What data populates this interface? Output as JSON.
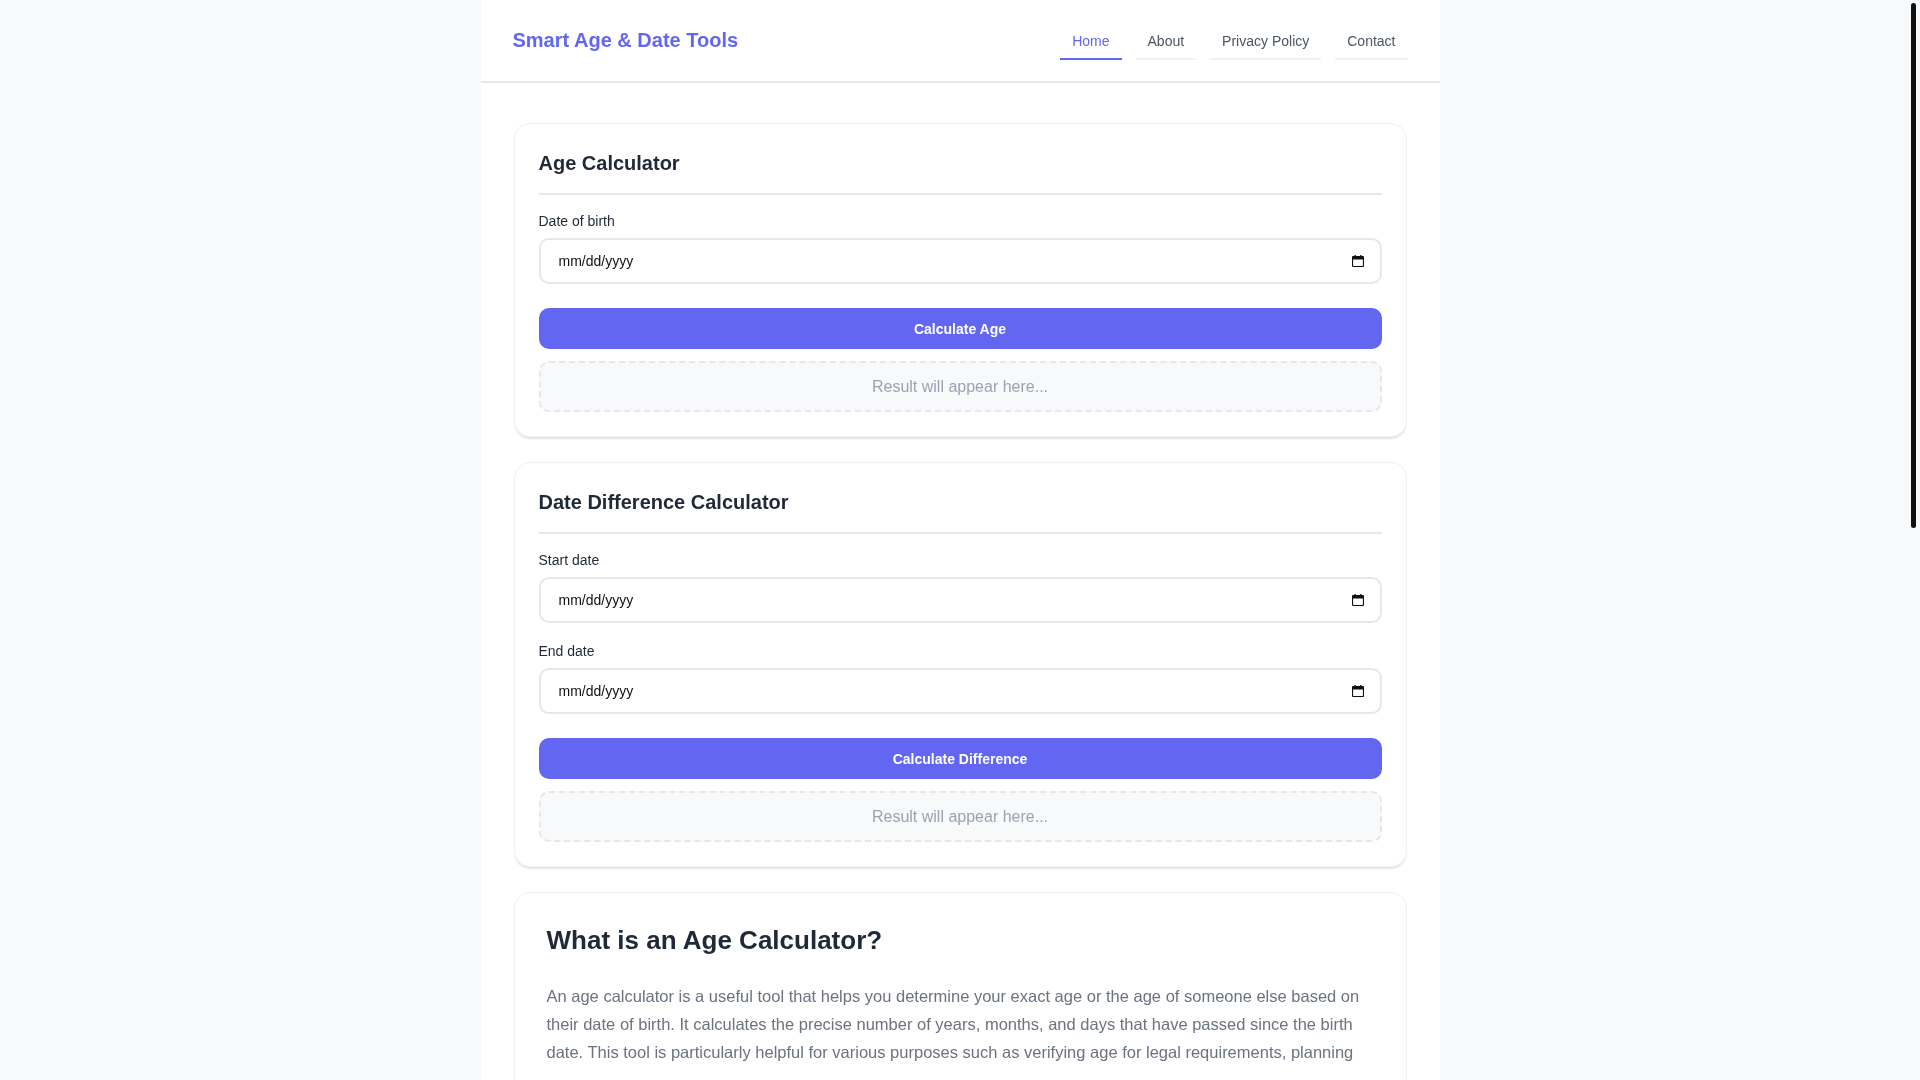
{
  "header": {
    "logo": "Smart Age & Date Tools",
    "nav": [
      {
        "label": "Home",
        "selected": true
      },
      {
        "label": "About",
        "selected": false
      },
      {
        "label": "Privacy Policy",
        "selected": false
      },
      {
        "label": "Contact",
        "selected": false
      }
    ]
  },
  "calculators": [
    {
      "title": "Age Calculator",
      "fields": [
        {
          "label": "Date of birth",
          "placeholder": "mm/dd/yyyy"
        }
      ],
      "button": "Calculate Age",
      "result": "Result will appear here..."
    },
    {
      "title": "Date Difference Calculator",
      "fields": [
        {
          "label": "Start date",
          "placeholder": "mm/dd/yyyy"
        },
        {
          "label": "End date",
          "placeholder": "mm/dd/yyyy"
        }
      ],
      "button": "Calculate Difference",
      "result": "Result will appear here..."
    }
  ],
  "article": {
    "heading": "What is an Age Calculator?",
    "paragraph": "An age calculator is a useful tool that helps you determine your exact age or the age of someone else based on their date of birth. It calculates the precise number of years, months, and days that have passed since the birth date. This tool is particularly helpful for various purposes such as verifying age for legal requirements, planning"
  }
}
